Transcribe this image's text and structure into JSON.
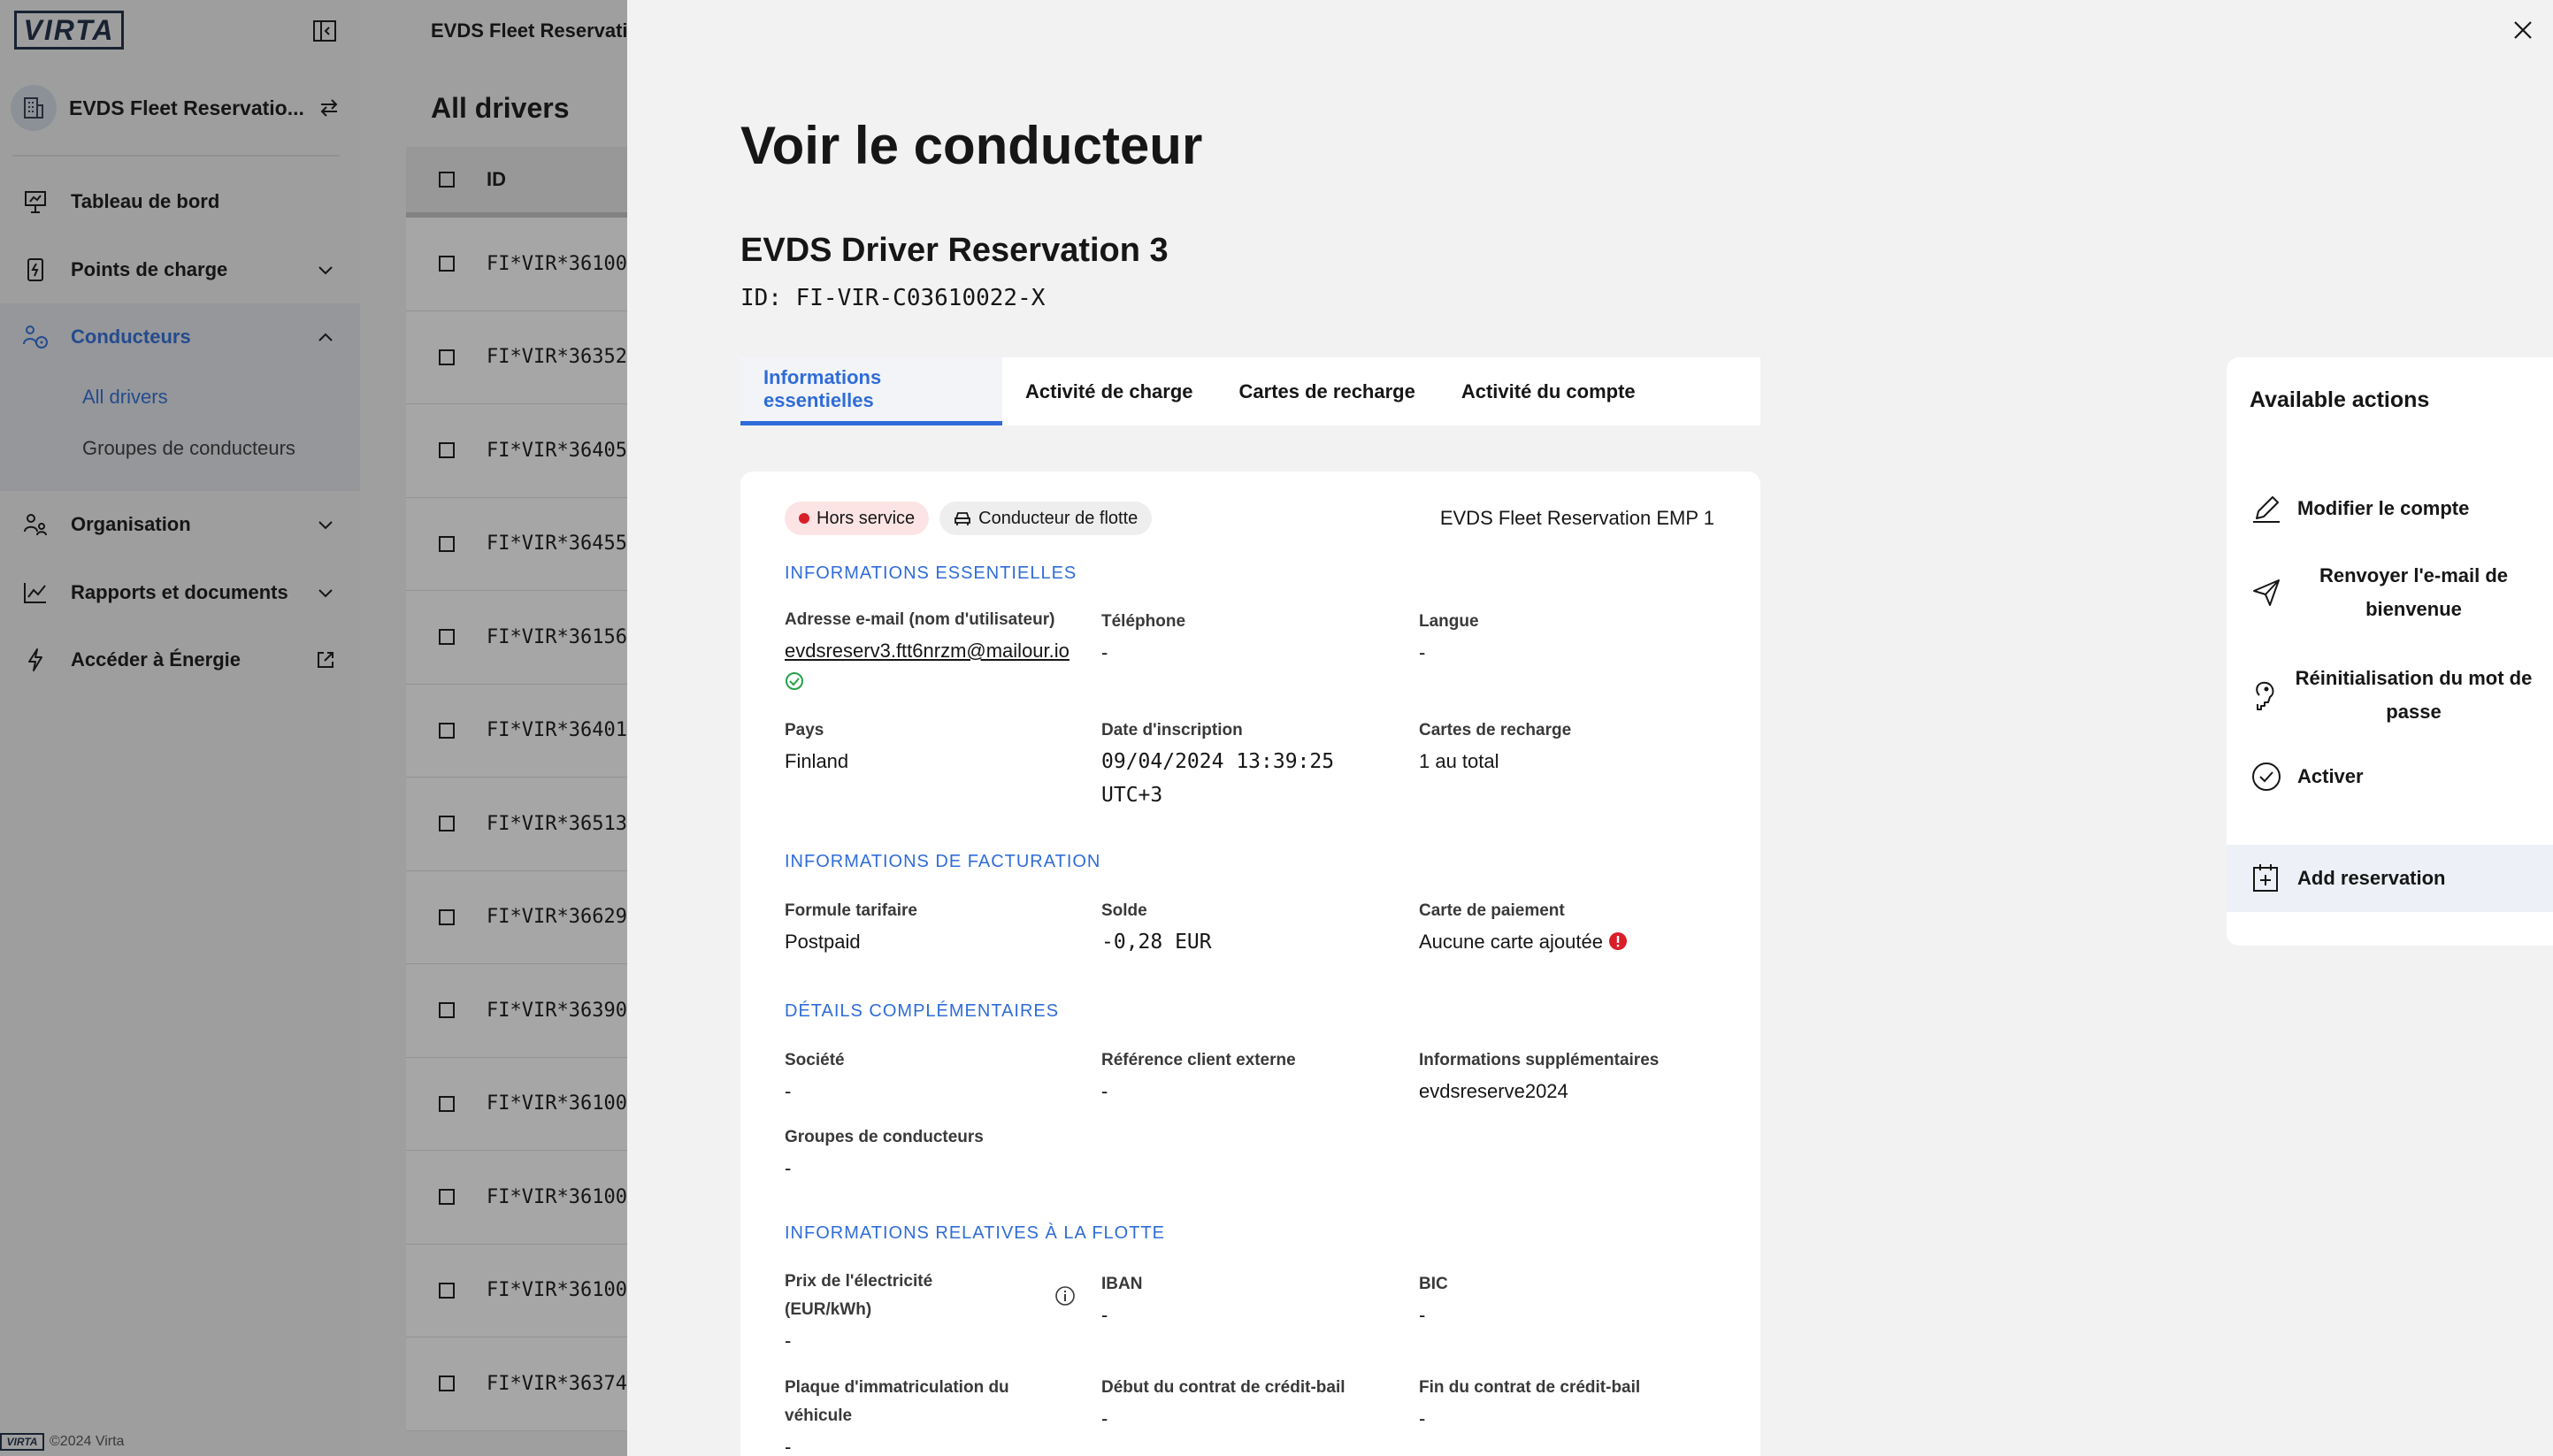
{
  "sidebar": {
    "logo": "VIRTA",
    "org_name": "EVDS Fleet Reservatio...",
    "nav": [
      {
        "label": "Tableau de bord",
        "icon": "presentation-icon"
      },
      {
        "label": "Points de charge",
        "icon": "charger-icon"
      },
      {
        "label": "Conducteurs",
        "icon": "drivers-icon"
      },
      {
        "label": "Organisation",
        "icon": "organisation-icon"
      },
      {
        "label": "Rapports et documents",
        "icon": "chart-line-icon"
      },
      {
        "label": "Accéder à Énergie",
        "icon": "bolt-icon"
      }
    ],
    "sub_items": [
      "All drivers",
      "Groupes de conducteurs"
    ],
    "footer_logo": "VIRTA",
    "footer": "©2024 Virta"
  },
  "main": {
    "header": "EVDS Fleet Reservati",
    "title": "All drivers",
    "table_header": "ID",
    "rows": [
      "FI*VIR*36100",
      "FI*VIR*36352",
      "FI*VIR*36405",
      "FI*VIR*36455",
      "FI*VIR*36156",
      "FI*VIR*36401",
      "FI*VIR*36513",
      "FI*VIR*36629",
      "FI*VIR*36390",
      "FI*VIR*36100",
      "FI*VIR*36100",
      "FI*VIR*36100",
      "FI*VIR*36374"
    ]
  },
  "drawer": {
    "title": "Voir le conducteur",
    "driver_name": "EVDS Driver Reservation 3",
    "driver_id": "ID: FI-VIR-C03610022-X",
    "tabs": [
      "Informations essentielles",
      "Activité de charge",
      "Cartes de recharge",
      "Activité du compte"
    ],
    "status_badge": "Hors service",
    "role_badge": "Conducteur de flotte",
    "employer": "EVDS Fleet Reservation EMP 1",
    "sections": {
      "essentials": "INFORMATIONS ESSENTIELLES",
      "billing": "INFORMATIONS DE FACTURATION",
      "details": "DÉTAILS COMPLÉMENTAIRES",
      "fleet": "INFORMATIONS RELATIVES À LA FLOTTE"
    },
    "fields": {
      "email_label": "Adresse e-mail (nom d'utilisateur)",
      "email_value": "evdsreserv3.ftt6nrzm@mailour.io",
      "phone_label": "Téléphone",
      "phone_value": "-",
      "language_label": "Langue",
      "language_value": "-",
      "country_label": "Pays",
      "country_value": "Finland",
      "signup_label": "Date d'inscription",
      "signup_value": "09/04/2024 13:39:25 UTC+3",
      "cards_label": "Cartes de recharge",
      "cards_value": "1 au total",
      "plan_label": "Formule tarifaire",
      "plan_value": "Postpaid",
      "balance_label": "Solde",
      "balance_value": "-0,28 EUR",
      "payment_label": "Carte de paiement",
      "payment_value": "Aucune carte ajoutée",
      "company_label": "Société",
      "company_value": "-",
      "extref_label": "Référence client externe",
      "extref_value": "-",
      "extra_label": "Informations supplémentaires",
      "extra_value": "evdsreserve2024",
      "groups_label": "Groupes de conducteurs",
      "groups_value": "-",
      "price_label": "Prix de l'électricité (EUR/kWh)",
      "price_value": "-",
      "iban_label": "IBAN",
      "iban_value": "-",
      "bic_label": "BIC",
      "bic_value": "-",
      "plate_label": "Plaque d'immatriculation du véhicule",
      "plate_value": "-",
      "lease_start_label": "Début du contrat de crédit-bail",
      "lease_start_value": "-",
      "lease_end_label": "Fin du contrat de crédit-bail",
      "lease_end_value": "-"
    }
  },
  "actions": {
    "title": "Available actions",
    "items": [
      "Modifier le compte",
      "Renvoyer l'e-mail de bienvenue",
      "Réinitialisation du mot de passe",
      "Activer",
      "Add reservation"
    ]
  },
  "colors": {
    "accent": "#2f6cd8",
    "danger": "#da1e28",
    "success": "#24a148"
  }
}
